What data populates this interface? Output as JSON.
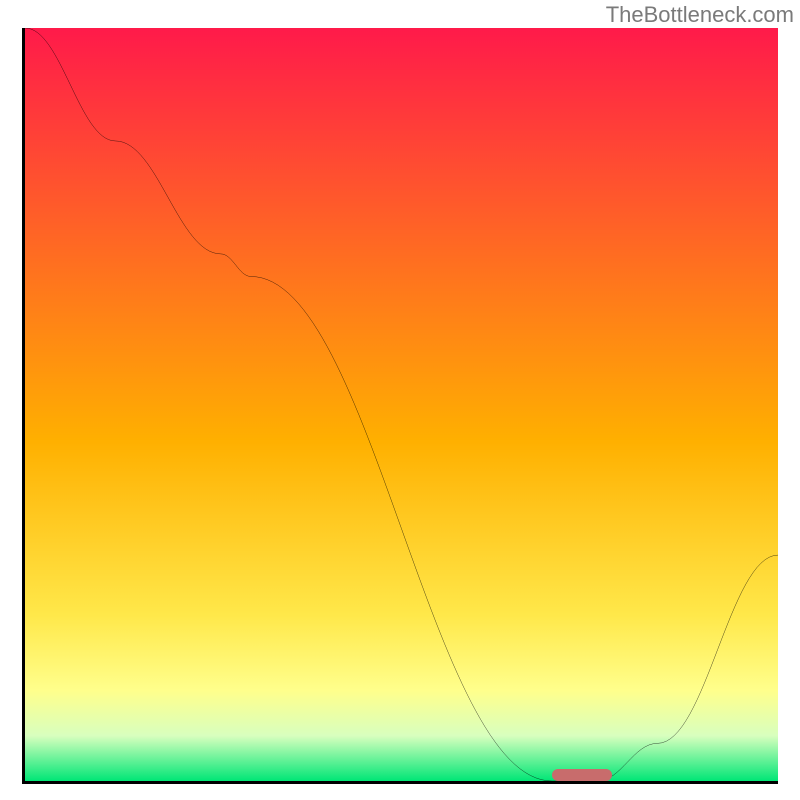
{
  "watermark": "TheBottleneck.com",
  "colors": {
    "top": "#ff1a4a",
    "mid": "#ffd400",
    "low1": "#ffff8c",
    "low2": "#d8ffbe",
    "bottom": "#00e676",
    "curve": "#000000",
    "marker": "#c86c6c"
  },
  "chart_data": {
    "type": "line",
    "title": "",
    "xlabel": "",
    "ylabel": "",
    "xlim": [
      0,
      100
    ],
    "ylim": [
      0,
      100
    ],
    "series": [
      {
        "name": "bottleneck-curve",
        "x": [
          0,
          12,
          26,
          30,
          70,
          76,
          84,
          100
        ],
        "y": [
          100,
          85,
          70,
          67,
          0,
          0,
          5,
          30
        ]
      }
    ],
    "marker": {
      "x_start": 70,
      "x_end": 78,
      "y": 0.5
    },
    "gradient_stops": [
      {
        "pct": 0,
        "color": "#ff1a4a"
      },
      {
        "pct": 55,
        "color": "#ffb000"
      },
      {
        "pct": 78,
        "color": "#ffe84a"
      },
      {
        "pct": 88,
        "color": "#ffff8c"
      },
      {
        "pct": 94,
        "color": "#d8ffbe"
      },
      {
        "pct": 100,
        "color": "#00e676"
      }
    ]
  }
}
